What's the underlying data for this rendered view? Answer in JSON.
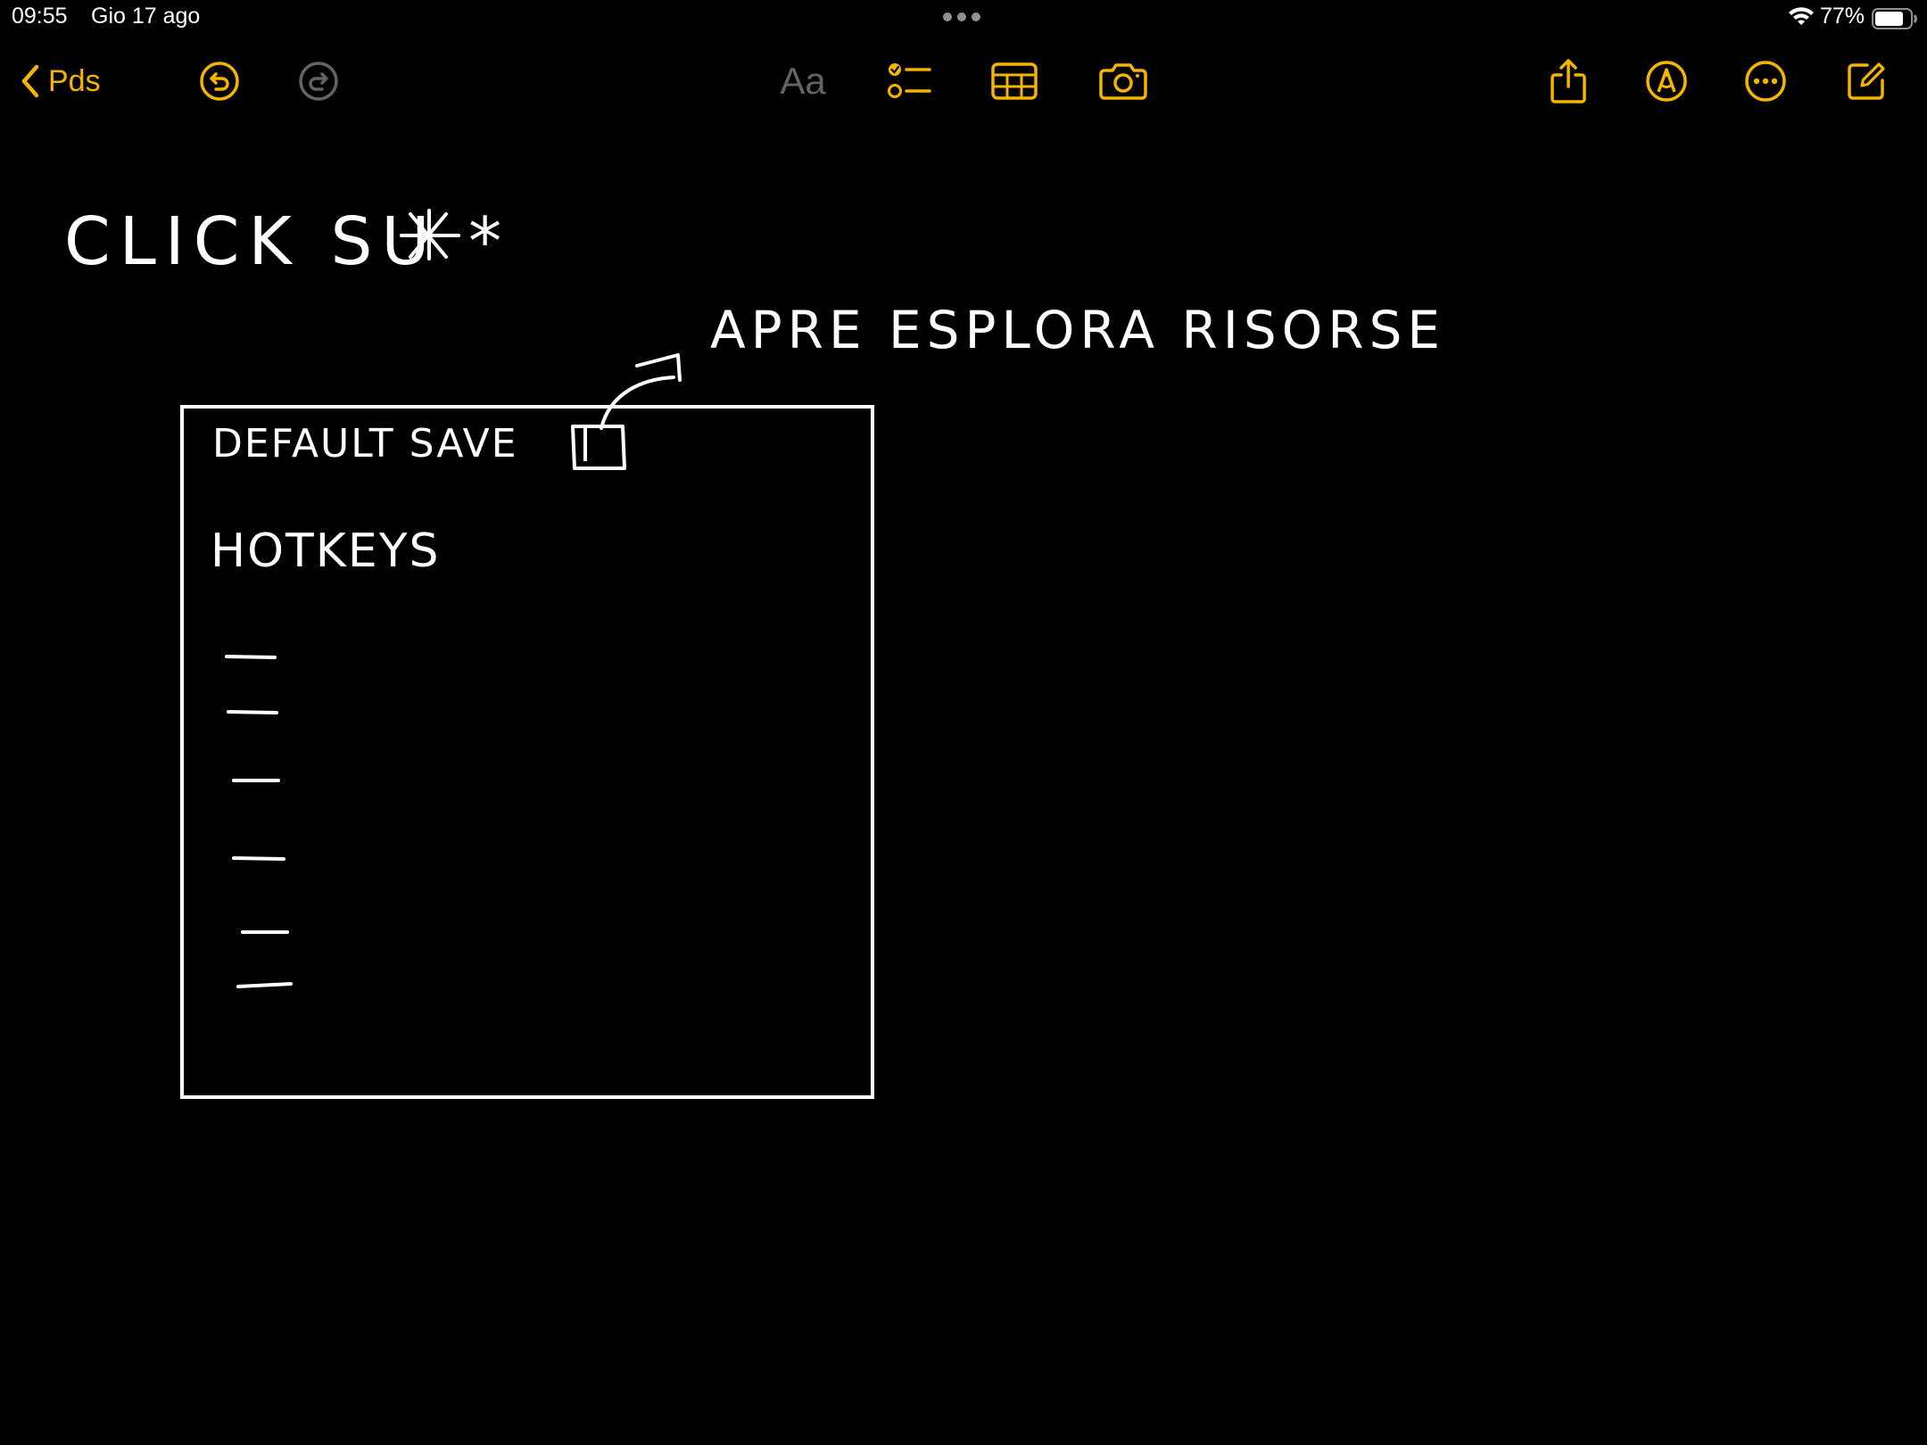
{
  "status_bar": {
    "time": "09:55",
    "date": "Gio 17 ago",
    "battery": "77%"
  },
  "toolbar": {
    "back_label": "Pds",
    "format_label": "Aa",
    "icons": {
      "back": "chevron-left-icon",
      "undo": "undo-icon",
      "redo": "redo-icon",
      "format": "text-format-icon",
      "checklist": "checklist-icon",
      "table": "table-icon",
      "camera": "camera-icon",
      "share": "share-icon",
      "markup": "markup-pen-icon",
      "more": "more-icon",
      "compose": "compose-icon"
    },
    "accent_color": "#f5b400"
  },
  "note": {
    "handwriting": {
      "line1": "CLICK SU *",
      "annotation": "APRE ESPLORA RISORSE",
      "box_line1": "DEFAULT SAVE",
      "box_line2": "HOTKEYS"
    },
    "box_list_dashes": 6
  }
}
